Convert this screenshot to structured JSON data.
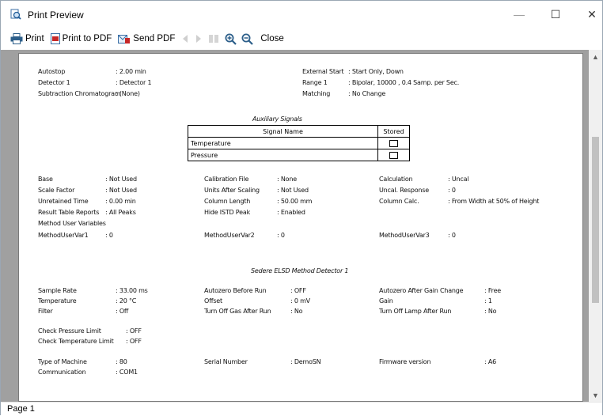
{
  "window": {
    "title": "Print Preview",
    "minimize_glyph": "—",
    "maximize_glyph": "☐",
    "close_glyph": "✕"
  },
  "toolbar": {
    "print": "Print",
    "print_pdf": "Print to PDF",
    "send_pdf": "Send PDF",
    "close": "Close",
    "icons": [
      "printer-icon",
      "pdf-icon",
      "send-pdf-icon",
      "previous-page-icon",
      "next-page-icon",
      "multi-page-icon",
      "zoom-in-icon",
      "zoom-out-icon"
    ]
  },
  "status": {
    "page": "Page 1"
  },
  "doc": {
    "top": {
      "autostop_label": "Autostop",
      "autostop_value": ": 2.00 min",
      "detector_label": "Detector 1",
      "detector_value": ": Detector 1",
      "subtraction_label": "Subtraction Chromatogram",
      "subtraction_value": ": (None)",
      "ext_start_label": "External Start",
      "ext_start_value": ": Start Only, Down",
      "range_label": "Range 1",
      "range_value": ": Bipolar, 10000 , 0.4 Samp. per Sec.",
      "matching_label": "Matching",
      "matching_value": ": No Change"
    },
    "aux": {
      "title": "Auxiliary Signals",
      "col_signal": "Signal Name",
      "col_stored": "Stored",
      "rows": [
        "Temperature",
        "Pressure"
      ]
    },
    "mid": {
      "base_l": "Base",
      "base_v": ": Not Used",
      "scale_l": "Scale Factor",
      "scale_v": ": Not Used",
      "unret_l": "Unretained Time",
      "unret_v": ": 0.00 min",
      "result_l": "Result Table Reports",
      "result_v": ": All Peaks",
      "muv_l": "Method User Variables",
      "muv1_l": "MethodUserVar1",
      "muv1_v": ": 0",
      "calfile_l": "Calibration File",
      "calfile_v": ": None",
      "units_l": "Units After Scaling",
      "units_v": ": Not Used",
      "collen_l": "Column Length",
      "collen_v": ": 50.00 mm",
      "hide_l": "Hide ISTD Peak",
      "hide_v": ": Enabled",
      "muv2_l": "MethodUserVar2",
      "muv2_v": ": 0",
      "calc_l": "Calculation",
      "calc_v": ": Uncal",
      "uncal_l": "Uncal. Response",
      "uncal_v": ": 0",
      "colcalc_l": "Column Calc.",
      "colcalc_v": ": From Width at 50% of Height",
      "muv3_l": "MethodUserVar3",
      "muv3_v": ": 0"
    },
    "elsd": {
      "title": "Sedere ELSD Method Detector 1",
      "rate_l": "Sample Rate",
      "rate_v": ": 33.00 ms",
      "temp_l": "Temperature",
      "temp_v": ": 20 °C",
      "filter_l": "Filter",
      "filter_v": ": Off",
      "azbr_l": "Autozero Before Run",
      "azbr_v": ": OFF",
      "offset_l": "Offset",
      "offset_v": ": 0 mV",
      "gas_l": "Turn Off Gas After Run",
      "gas_v": ": No",
      "azgc_l": "Autozero After Gain Change",
      "azgc_v": ": Free",
      "gain_l": "Gain",
      "gain_v": ": 1",
      "lamp_l": "Turn Off Lamp After Run",
      "lamp_v": ": No",
      "cpl_l": "Check Pressure Limit",
      "cpl_v": ": OFF",
      "ctl_l": "Check Temperature Limit",
      "ctl_v": ": OFF",
      "tom_l": "Type of Machine",
      "tom_v": ": 80",
      "comm_l": "Communication",
      "comm_v": ": COM1",
      "serial_l": "Serial Number",
      "serial_v": ": DemoSN",
      "fw_l": "Firmware version",
      "fw_v": ": A6"
    }
  }
}
